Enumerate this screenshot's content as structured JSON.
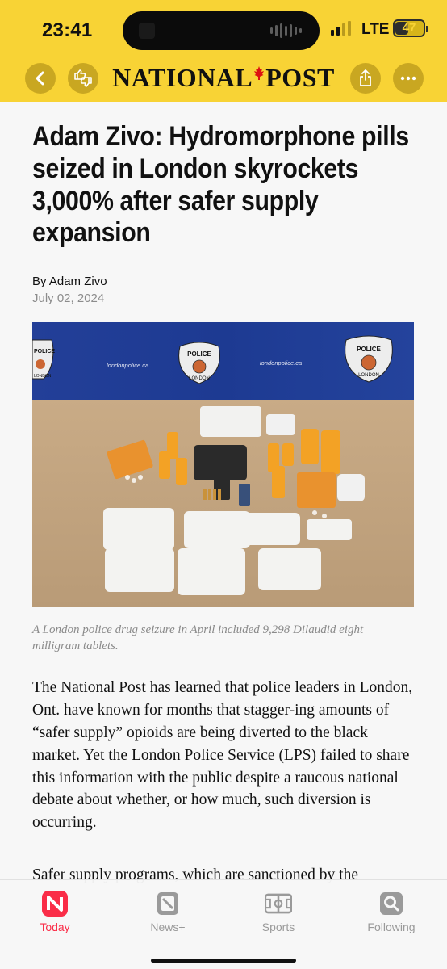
{
  "status": {
    "time": "23:41",
    "network": "LTE",
    "battery": "47",
    "battery_level": 0.47
  },
  "header": {
    "logo_left": "NATIONAL",
    "logo_right": "POST"
  },
  "article": {
    "headline": "Adam Zivo: Hydromorphone pills seized in London skyrockets 3,000% after safer supply expansion",
    "byline": "By Adam Zivo",
    "date": "July 02, 2024",
    "photo_text": {
      "left_badge": "POLICE",
      "left_badge_sub": "LONDON",
      "site_left": "londonpolice.ca",
      "center_badge": "POLICE",
      "center_badge_sub": "LONDON",
      "site_right": "londonpolice.ca",
      "right_badge": "POLICE",
      "right_badge_sub": "LONDON"
    },
    "caption": "A London police drug seizure in April included 9,298 Dilaudid eight milligram tablets.",
    "paragraph1": "The National Post has learned that police leaders in London, Ont. have known for months that stagger-ing amounts of “safer supply” opioids are being diverted to the black market. Yet the London Police Service (LPS) failed to share this information with the public despite a raucous national debate about whether, or how much, such diversion is occurring.",
    "paragraph2": "Safer supply programs, which are sanctioned by the"
  },
  "tabs": [
    {
      "label": "Today",
      "icon": "news-logo-icon",
      "active": true
    },
    {
      "label": "News+",
      "icon": "news-plus-icon",
      "active": false
    },
    {
      "label": "Sports",
      "icon": "sports-field-icon",
      "active": false
    },
    {
      "label": "Following",
      "icon": "following-search-icon",
      "active": false
    }
  ],
  "colors": {
    "header": "#f8d335",
    "accent": "#fa2d48",
    "backdrop": "#1f3e98"
  }
}
